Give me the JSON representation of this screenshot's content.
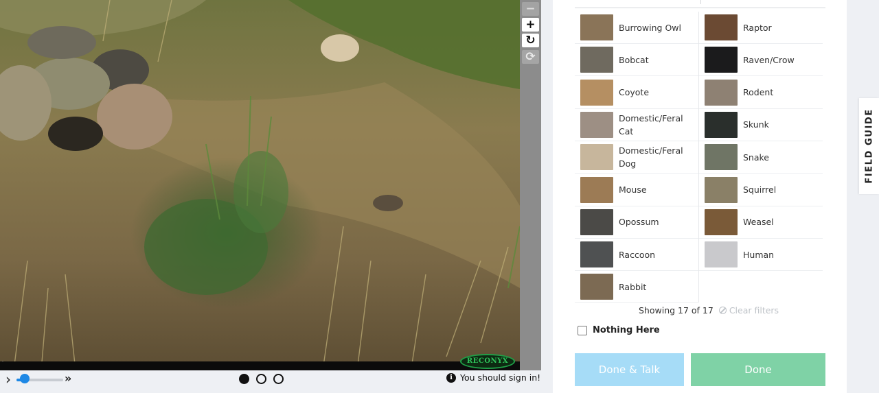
{
  "viewer": {
    "watermark": "RECONYX",
    "zoom_out_symbol": "−",
    "zoom_in_symbol": "+",
    "rotate_symbol": "↻",
    "reset_symbol": "⟳"
  },
  "controls": {
    "play_icon": "chevron-right-icon",
    "play_symbol": "›",
    "speed_slider_value": 0.18,
    "fast_forward_symbol": "»",
    "frames": [
      {
        "selected": true
      },
      {
        "selected": false
      },
      {
        "selected": false
      }
    ],
    "signin_text": "You should sign in!",
    "info_symbol": "i"
  },
  "choices": [
    {
      "label": "Burrowing Owl",
      "color": "#8a7458"
    },
    {
      "label": "Raptor",
      "color": "#6b4a33"
    },
    {
      "label": "Bobcat",
      "color": "#6f6a5f"
    },
    {
      "label": "Raven/Crow",
      "color": "#1b1b1c"
    },
    {
      "label": "Coyote",
      "color": "#b58f62"
    },
    {
      "label": "Rodent",
      "color": "#8e8173"
    },
    {
      "label": "Domestic/Feral Cat",
      "color": "#9d8f84"
    },
    {
      "label": "Skunk",
      "color": "#2a2f2c"
    },
    {
      "label": "Domestic/Feral Dog",
      "color": "#c7b69c"
    },
    {
      "label": "Snake",
      "color": "#6f7565"
    },
    {
      "label": "Mouse",
      "color": "#9c7b55"
    },
    {
      "label": "Squirrel",
      "color": "#8a8067"
    },
    {
      "label": "Opossum",
      "color": "#4b4a47"
    },
    {
      "label": "Weasel",
      "color": "#7a5a38"
    },
    {
      "label": "Raccoon",
      "color": "#4f5152"
    },
    {
      "label": "Human",
      "color": "#c9c9cc"
    },
    {
      "label": "Rabbit",
      "color": "#7c6a53"
    }
  ],
  "filters": {
    "showing": "Showing 17 of 17",
    "clear": "Clear filters"
  },
  "nothing_here": {
    "label": "Nothing Here",
    "checked": false
  },
  "buttons": {
    "done_talk": "Done & Talk",
    "done": "Done"
  },
  "field_guide": "FIELD GUIDE",
  "colors": {
    "done_talk_bg": "#a6dcf7",
    "done_bg": "#7fd2a6",
    "slider": "#1e88e5"
  }
}
